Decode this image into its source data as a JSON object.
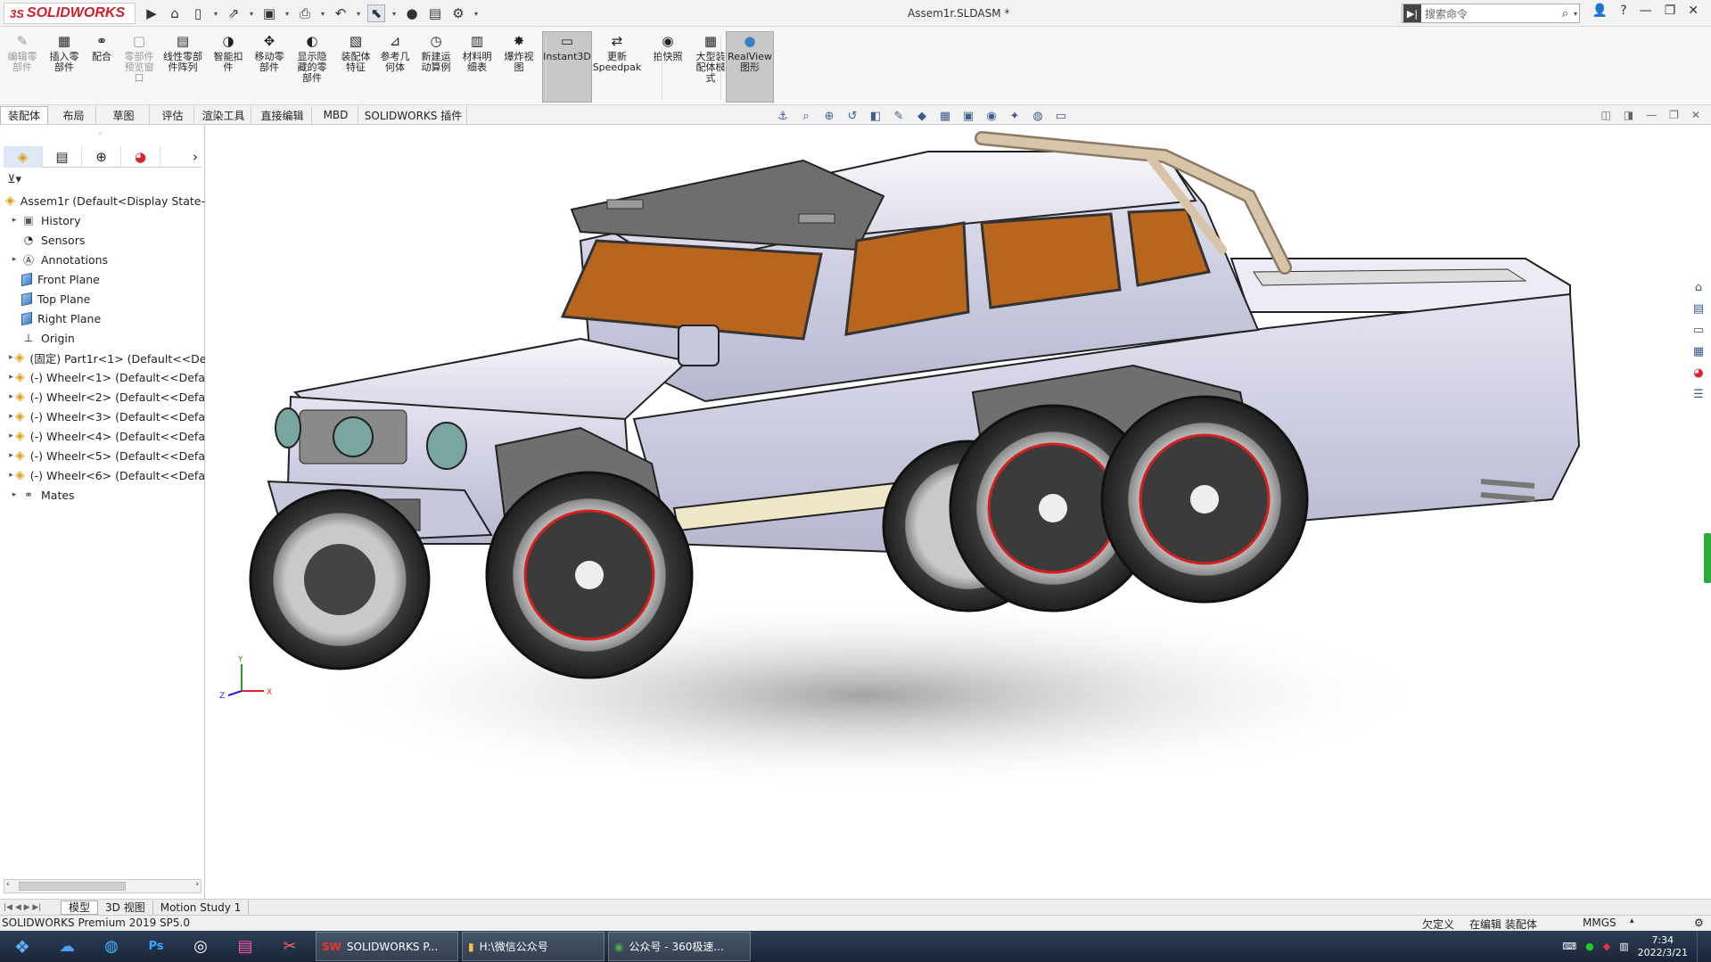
{
  "app": {
    "logo": "SOLIDWORKS",
    "doc_title": "Assem1r.SLDASM *",
    "search_placeholder": "搜索命令"
  },
  "ribbon": {
    "buttons": [
      {
        "label": "编辑零\n部件",
        "icon": "edit-component-icon",
        "disabled": true
      },
      {
        "label": "插入零\n部件",
        "icon": "insert-component-icon"
      },
      {
        "label": "配合",
        "icon": "mate-icon"
      },
      {
        "label": "零部件\n预览窗\n口",
        "icon": "preview-window-icon",
        "disabled": true
      },
      {
        "label": "线性零部\n件阵列",
        "icon": "linear-pattern-icon"
      },
      {
        "label": "智能扣\n件",
        "icon": "smart-fastener-icon"
      },
      {
        "label": "移动零\n部件",
        "icon": "move-component-icon"
      },
      {
        "label": "显示隐\n藏的零\n部件",
        "icon": "show-hidden-icon"
      },
      {
        "label": "装配体\n特征",
        "icon": "assembly-feature-icon"
      },
      {
        "label": "参考几\n何体",
        "icon": "reference-geometry-icon"
      },
      {
        "label": "新建运\n动算例",
        "icon": "new-motion-study-icon"
      },
      {
        "label": "材料明\n细表",
        "icon": "bom-icon"
      },
      {
        "label": "爆炸视\n图",
        "icon": "exploded-view-icon"
      },
      {
        "label": "Instant3D",
        "icon": "instant3d-icon",
        "active": true
      },
      {
        "label": "更新\nSpeedpak",
        "icon": "speedpak-icon"
      },
      {
        "label": "拍快照",
        "icon": "snapshot-icon"
      },
      {
        "label": "大型装\n配体模\n式",
        "icon": "large-assembly-icon"
      },
      {
        "label": "RealView\n图形",
        "icon": "realview-icon",
        "active": true
      }
    ]
  },
  "tabs": [
    "装配体",
    "布局",
    "草图",
    "评估",
    "渲染工具",
    "直接编辑",
    "MBD",
    "SOLIDWORKS 插件"
  ],
  "feature_tree": {
    "root": "Assem1r  (Default<Display State-1",
    "items": [
      {
        "label": "History",
        "icon": "history-folder-icon",
        "expand": true
      },
      {
        "label": "Sensors",
        "icon": "sensors-icon",
        "expand": false
      },
      {
        "label": "Annotations",
        "icon": "annotations-icon",
        "expand": true
      },
      {
        "label": "Front Plane",
        "icon": "plane-icon",
        "expand": false
      },
      {
        "label": "Top Plane",
        "icon": "plane-icon",
        "expand": false
      },
      {
        "label": "Right Plane",
        "icon": "plane-icon",
        "expand": false
      },
      {
        "label": "Origin",
        "icon": "origin-icon",
        "expand": false
      },
      {
        "label": "(固定) Part1r<1> (Default<<De",
        "icon": "part-icon",
        "expand": true
      },
      {
        "label": "(-) Wheelr<1> (Default<<Defa",
        "icon": "part-icon",
        "expand": true
      },
      {
        "label": "(-) Wheelr<2> (Default<<Defa",
        "icon": "part-icon",
        "expand": true
      },
      {
        "label": "(-) Wheelr<3> (Default<<Defa",
        "icon": "part-icon",
        "expand": true
      },
      {
        "label": "(-) Wheelr<4> (Default<<Defa",
        "icon": "part-icon",
        "expand": true
      },
      {
        "label": "(-) Wheelr<5> (Default<<Defa",
        "icon": "part-icon",
        "expand": true
      },
      {
        "label": "(-) Wheelr<6> (Default<<Defa",
        "icon": "part-icon",
        "expand": true
      },
      {
        "label": "Mates",
        "icon": "mates-icon",
        "expand": true
      }
    ]
  },
  "bottom_tabs": [
    "模型",
    "3D 视图",
    "Motion Study 1"
  ],
  "status": {
    "product": "SOLIDWORKS Premium 2019 SP5.0",
    "state": "欠定义",
    "mode": "在编辑 装配体",
    "units": "MMGS"
  },
  "taskbar": {
    "windows": [
      {
        "label": "SOLIDWORKS P...",
        "icon": "solidworks-icon"
      },
      {
        "label": "H:\\微信公众号",
        "icon": "folder-icon"
      },
      {
        "label": "公众号 - 360极速...",
        "icon": "browser-icon"
      }
    ],
    "time": "7:34",
    "date": "2022/3/21"
  },
  "colors": {
    "body": "#c9c9e0",
    "glass": "#b8661e",
    "tire": "#3a3a3a",
    "rim_accent": "#d62020",
    "rollbar": "#d8c4a8"
  }
}
